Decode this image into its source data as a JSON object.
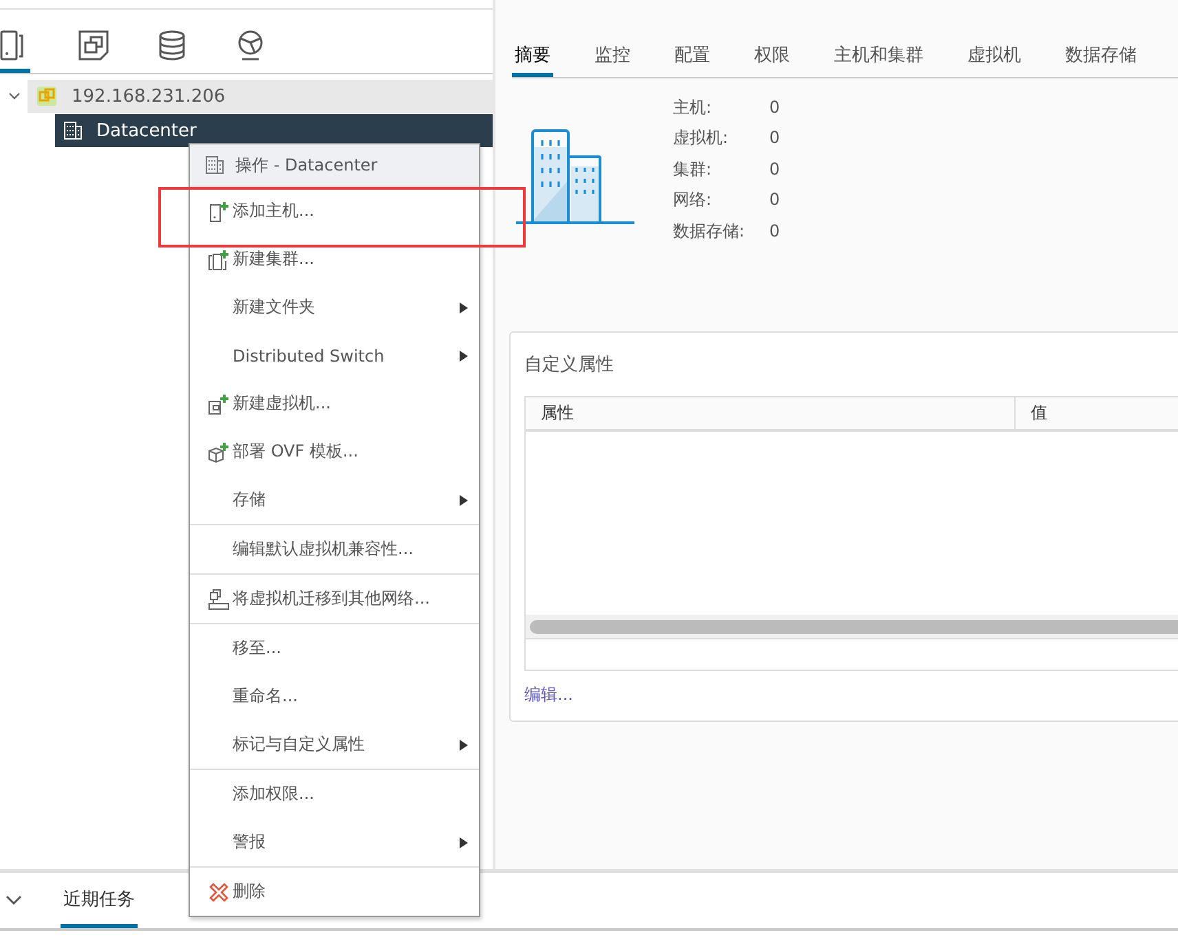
{
  "nav_tabs": [
    {
      "kind": "host",
      "selected": true
    },
    {
      "kind": "vm",
      "selected": false
    },
    {
      "kind": "storage",
      "selected": false
    },
    {
      "kind": "network",
      "selected": false
    }
  ],
  "tree": {
    "label": "192.168.231.206",
    "expanded": true,
    "selected": false,
    "children": [
      {
        "label": "Datacenter",
        "selected": true
      }
    ]
  },
  "tabs": [
    {
      "label": "摘要",
      "selected": true
    },
    {
      "label": "监控",
      "selected": false
    },
    {
      "label": "配置",
      "selected": false
    },
    {
      "label": "权限",
      "selected": false
    },
    {
      "label": "主机和集群",
      "selected": false
    },
    {
      "label": "虚拟机",
      "selected": false
    },
    {
      "label": "数据存储",
      "selected": false
    }
  ],
  "summary": [
    {
      "label": "主机:",
      "value": "0"
    },
    {
      "label": "虚拟机:",
      "value": "0"
    },
    {
      "label": "集群:",
      "value": "0"
    },
    {
      "label": "网络:",
      "value": "0"
    },
    {
      "label": "数据存储:",
      "value": "0"
    }
  ],
  "custom_attributes": {
    "title": "自定义属性",
    "columns": [
      "属性",
      "值"
    ],
    "edit_link": "编辑..."
  },
  "context_menu": {
    "title": "操作 - Datacenter",
    "groups": [
      [
        {
          "label": "添加主机...",
          "kind": "addhost",
          "submenu": false
        },
        {
          "label": "新建集群...",
          "kind": "addcluster",
          "submenu": false
        },
        {
          "label": "新建文件夹",
          "kind": "plain",
          "submenu": true
        },
        {
          "label": "Distributed Switch",
          "kind": "plain",
          "submenu": true
        },
        {
          "label": "新建虚拟机...",
          "kind": "addvm",
          "submenu": false
        },
        {
          "label": "部署 OVF 模板...",
          "kind": "deploy",
          "submenu": false
        },
        {
          "label": "存储",
          "kind": "plain",
          "submenu": true
        }
      ],
      [
        {
          "label": "编辑默认虚拟机兼容性...",
          "kind": "plain",
          "submenu": false
        }
      ],
      [
        {
          "label": "将虚拟机迁移到其他网络...",
          "kind": "migrate",
          "submenu": false
        }
      ],
      [
        {
          "label": "移至...",
          "kind": "plain",
          "submenu": false
        },
        {
          "label": "重命名...",
          "kind": "plain",
          "submenu": false
        },
        {
          "label": "标记与自定义属性",
          "kind": "plain",
          "submenu": true
        }
      ],
      [
        {
          "label": "添加权限...",
          "kind": "plain",
          "submenu": false
        },
        {
          "label": "警报",
          "kind": "plain",
          "submenu": true
        }
      ],
      [
        {
          "label": "删除",
          "kind": "delete",
          "submenu": false
        }
      ]
    ]
  },
  "annotation": {
    "kind": "box"
  },
  "bottom_panel": {
    "expanded": true,
    "tabs": [
      {
        "label": "近期任务",
        "selected": true
      }
    ]
  }
}
